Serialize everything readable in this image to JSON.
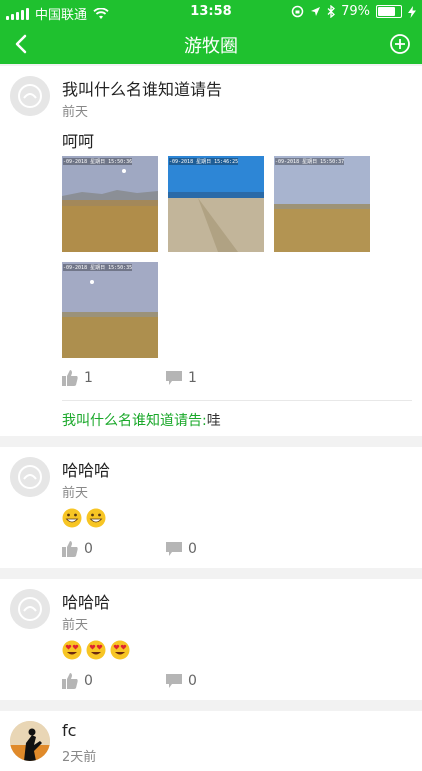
{
  "status_bar": {
    "carrier": "中国联通",
    "time": "13:58",
    "battery": "79%",
    "battery_level": 0.79
  },
  "nav": {
    "title": "游牧圈"
  },
  "posts": [
    {
      "name": "我叫什么名谁知道请告",
      "time": "前天",
      "content": "呵呵",
      "photo_captions": [
        "-09-2018 星期日 15:50:36",
        "-09-2018 星期日 15:46:25",
        "-09-2018 星期日 15:50:37",
        "-09-2018 星期日 15:50:35"
      ],
      "likes": "1",
      "comments": "1",
      "comment": {
        "author": "我叫什么名谁知道请告:",
        "text": "哇"
      }
    },
    {
      "name": "哈哈哈",
      "time": "前天",
      "emojis": [
        "grin-emoji",
        "grin-emoji"
      ],
      "likes": "0",
      "comments": "0"
    },
    {
      "name": "哈哈哈",
      "time": "前天",
      "emojis": [
        "heart-eyes-emoji",
        "heart-eyes-emoji",
        "heart-eyes-emoji"
      ],
      "likes": "0",
      "comments": "0"
    },
    {
      "name": "fc",
      "time": "2天前"
    }
  ],
  "colors": {
    "brand_green": "#1fc12f",
    "comment_green": "#1aa82a"
  }
}
